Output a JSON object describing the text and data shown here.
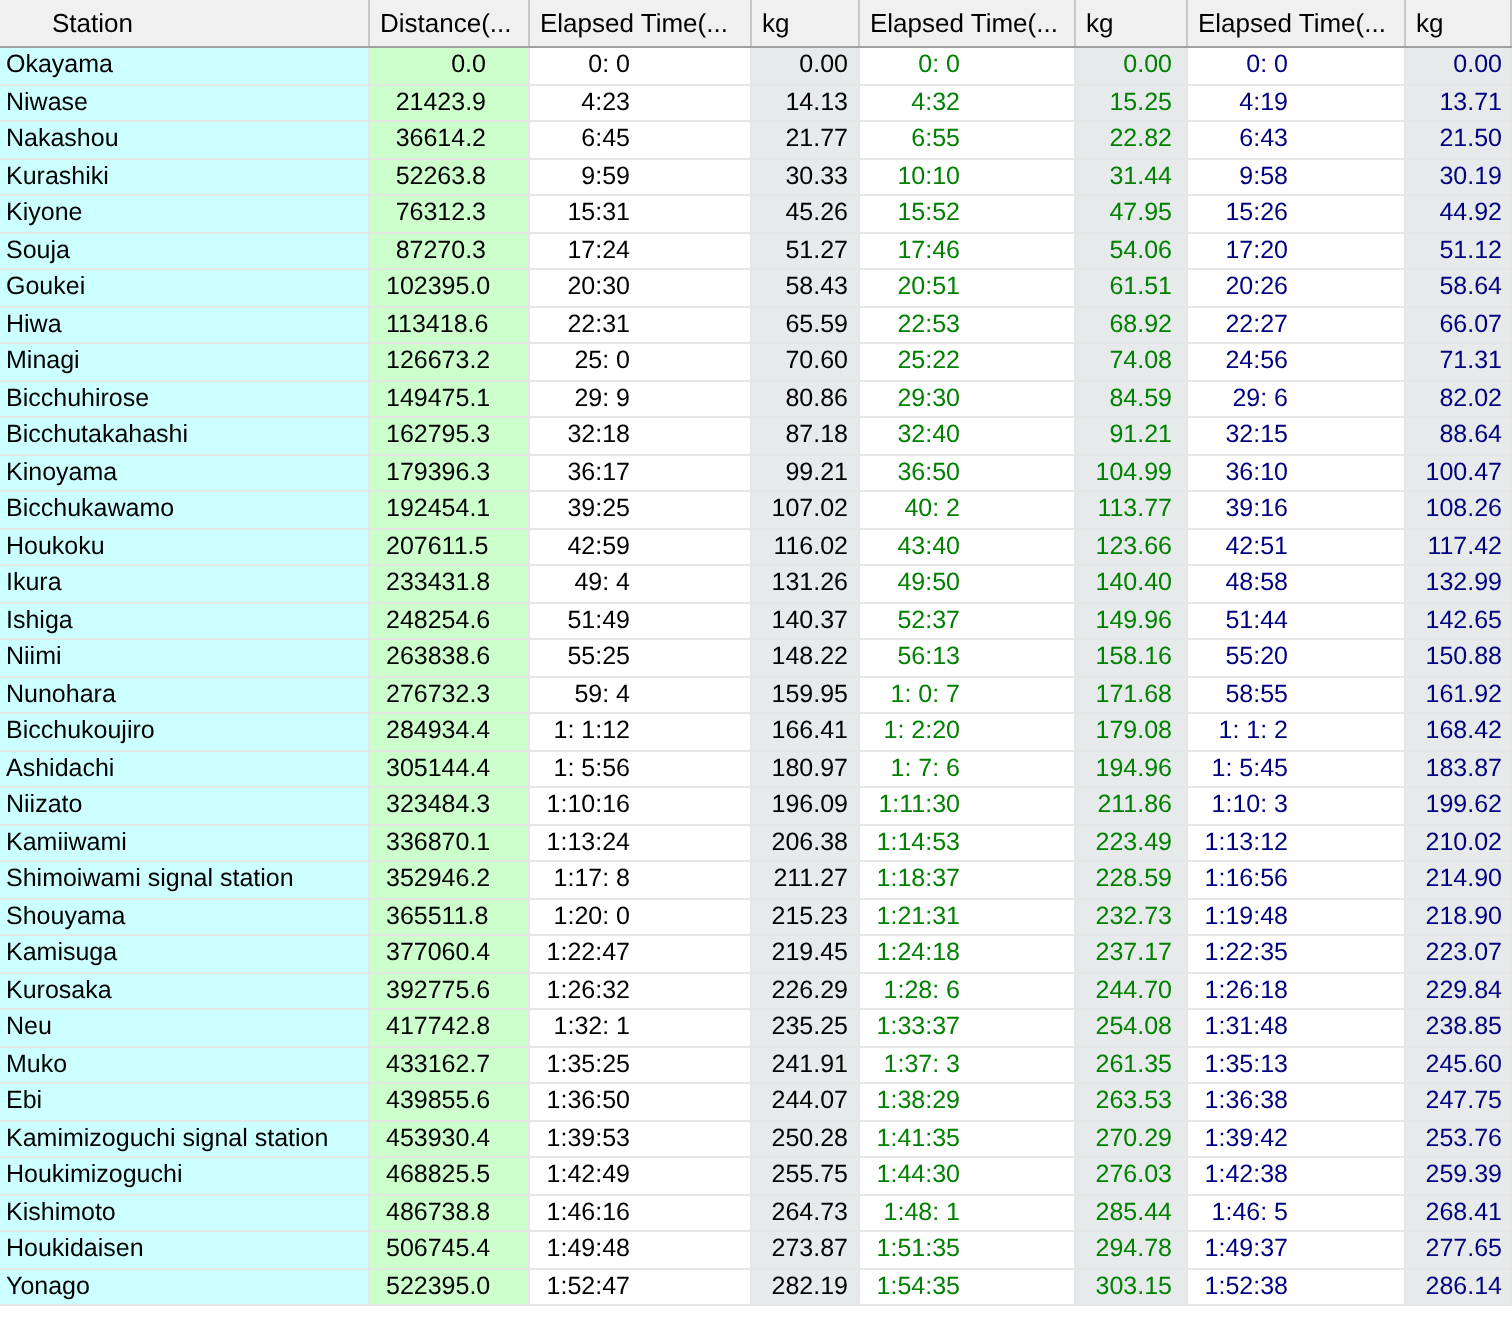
{
  "table": {
    "columns": [
      {
        "label": "Station",
        "kind": "station",
        "color": "#000000"
      },
      {
        "label": "Distance(...",
        "kind": "distance",
        "color": "#000000"
      },
      {
        "label": "Elapsed Time(...",
        "kind": "time",
        "color": "#000000"
      },
      {
        "label": "kg",
        "kind": "kg",
        "color": "#000000"
      },
      {
        "label": "Elapsed Time(...",
        "kind": "time",
        "color": "#008000"
      },
      {
        "label": "kg",
        "kind": "kg",
        "color": "#008000"
      },
      {
        "label": "Elapsed Time(...",
        "kind": "time",
        "color": "#000080"
      },
      {
        "label": "kg",
        "kind": "kg",
        "color": "#000080"
      }
    ],
    "rows": [
      [
        "Okayama",
        "0.0",
        "0: 0",
        "0.00",
        "0: 0",
        "0.00",
        "0: 0",
        "0.00"
      ],
      [
        "Niwase",
        "21423.9",
        "4:23",
        "14.13",
        "4:32",
        "15.25",
        "4:19",
        "13.71"
      ],
      [
        "Nakashou",
        "36614.2",
        "6:45",
        "21.77",
        "6:55",
        "22.82",
        "6:43",
        "21.50"
      ],
      [
        "Kurashiki",
        "52263.8",
        "9:59",
        "30.33",
        "10:10",
        "31.44",
        "9:58",
        "30.19"
      ],
      [
        "Kiyone",
        "76312.3",
        "15:31",
        "45.26",
        "15:52",
        "47.95",
        "15:26",
        "44.92"
      ],
      [
        "Souja",
        "87270.3",
        "17:24",
        "51.27",
        "17:46",
        "54.06",
        "17:20",
        "51.12"
      ],
      [
        "Goukei",
        "102395.0",
        "20:30",
        "58.43",
        "20:51",
        "61.51",
        "20:26",
        "58.64"
      ],
      [
        "Hiwa",
        "113418.6",
        "22:31",
        "65.59",
        "22:53",
        "68.92",
        "22:27",
        "66.07"
      ],
      [
        "Minagi",
        "126673.2",
        "25: 0",
        "70.60",
        "25:22",
        "74.08",
        "24:56",
        "71.31"
      ],
      [
        "Bicchuhirose",
        "149475.1",
        "29: 9",
        "80.86",
        "29:30",
        "84.59",
        "29: 6",
        "82.02"
      ],
      [
        "Bicchutakahashi",
        "162795.3",
        "32:18",
        "87.18",
        "32:40",
        "91.21",
        "32:15",
        "88.64"
      ],
      [
        "Kinoyama",
        "179396.3",
        "36:17",
        "99.21",
        "36:50",
        "104.99",
        "36:10",
        "100.47"
      ],
      [
        "Bicchukawamo",
        "192454.1",
        "39:25",
        "107.02",
        "40: 2",
        "113.77",
        "39:16",
        "108.26"
      ],
      [
        "Houkoku",
        "207611.5",
        "42:59",
        "116.02",
        "43:40",
        "123.66",
        "42:51",
        "117.42"
      ],
      [
        "Ikura",
        "233431.8",
        "49: 4",
        "131.26",
        "49:50",
        "140.40",
        "48:58",
        "132.99"
      ],
      [
        "Ishiga",
        "248254.6",
        "51:49",
        "140.37",
        "52:37",
        "149.96",
        "51:44",
        "142.65"
      ],
      [
        "Niimi",
        "263838.6",
        "55:25",
        "148.22",
        "56:13",
        "158.16",
        "55:20",
        "150.88"
      ],
      [
        "Nunohara",
        "276732.3",
        "59: 4",
        "159.95",
        "1: 0: 7",
        "171.68",
        "58:55",
        "161.92"
      ],
      [
        "Bicchukoujiro",
        "284934.4",
        "1: 1:12",
        "166.41",
        "1: 2:20",
        "179.08",
        "1: 1: 2",
        "168.42"
      ],
      [
        "Ashidachi",
        "305144.4",
        "1: 5:56",
        "180.97",
        "1: 7: 6",
        "194.96",
        "1: 5:45",
        "183.87"
      ],
      [
        "Niizato",
        "323484.3",
        "1:10:16",
        "196.09",
        "1:11:30",
        "211.86",
        "1:10: 3",
        "199.62"
      ],
      [
        "Kamiiwami",
        "336870.1",
        "1:13:24",
        "206.38",
        "1:14:53",
        "223.49",
        "1:13:12",
        "210.02"
      ],
      [
        "Shimoiwami signal station",
        "352946.2",
        "1:17: 8",
        "211.27",
        "1:18:37",
        "228.59",
        "1:16:56",
        "214.90"
      ],
      [
        "Shouyama",
        "365511.8",
        "1:20: 0",
        "215.23",
        "1:21:31",
        "232.73",
        "1:19:48",
        "218.90"
      ],
      [
        "Kamisuga",
        "377060.4",
        "1:22:47",
        "219.45",
        "1:24:18",
        "237.17",
        "1:22:35",
        "223.07"
      ],
      [
        "Kurosaka",
        "392775.6",
        "1:26:32",
        "226.29",
        "1:28: 6",
        "244.70",
        "1:26:18",
        "229.84"
      ],
      [
        "Neu",
        "417742.8",
        "1:32: 1",
        "235.25",
        "1:33:37",
        "254.08",
        "1:31:48",
        "238.85"
      ],
      [
        "Muko",
        "433162.7",
        "1:35:25",
        "241.91",
        "1:37: 3",
        "261.35",
        "1:35:13",
        "245.60"
      ],
      [
        "Ebi",
        "439855.6",
        "1:36:50",
        "244.07",
        "1:38:29",
        "263.53",
        "1:36:38",
        "247.75"
      ],
      [
        "Kamimizoguchi signal station",
        "453930.4",
        "1:39:53",
        "250.28",
        "1:41:35",
        "270.29",
        "1:39:42",
        "253.76"
      ],
      [
        "Houkimizoguchi",
        "468825.5",
        "1:42:49",
        "255.75",
        "1:44:30",
        "276.03",
        "1:42:38",
        "259.39"
      ],
      [
        "Kishimoto",
        "486738.8",
        "1:46:16",
        "264.73",
        "1:48: 1",
        "285.44",
        "1:46: 5",
        "268.41"
      ],
      [
        "Houkidaisen",
        "506745.4",
        "1:49:48",
        "273.87",
        "1:51:35",
        "294.78",
        "1:49:37",
        "277.65"
      ],
      [
        "Yonago",
        "522395.0",
        "1:52:47",
        "282.19",
        "1:54:35",
        "303.15",
        "1:52:38",
        "286.14"
      ]
    ]
  }
}
